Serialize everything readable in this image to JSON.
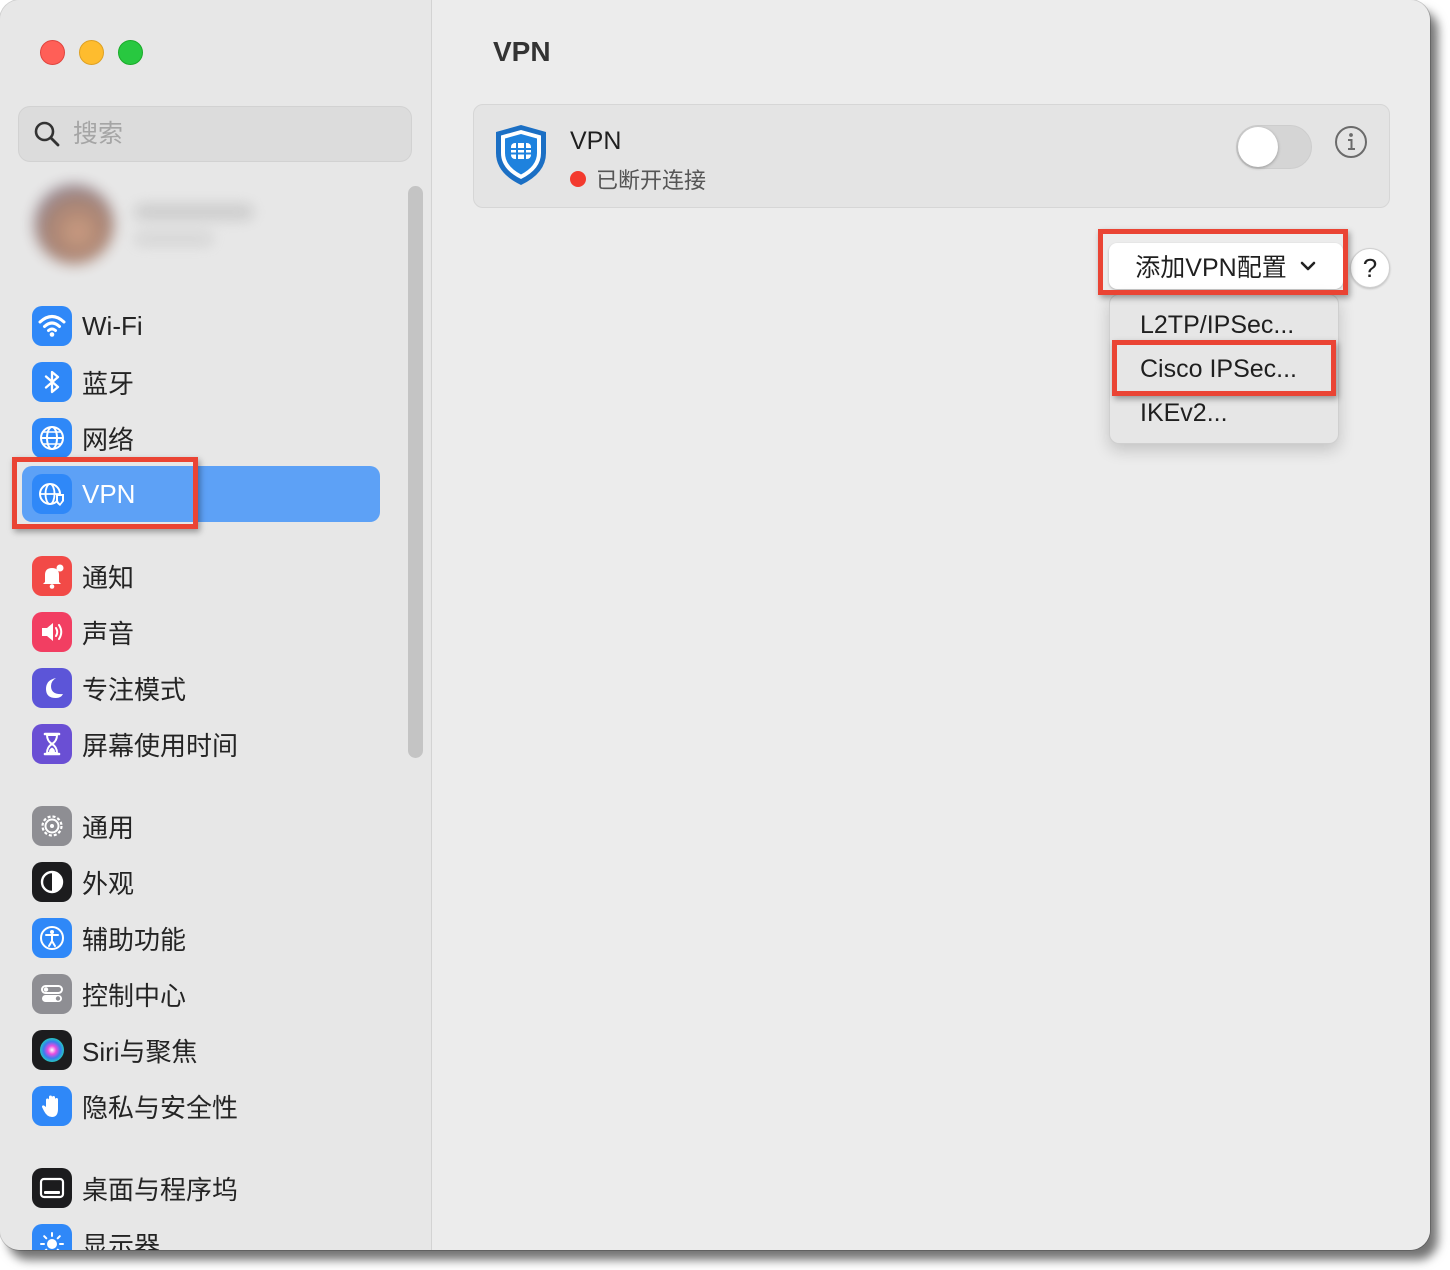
{
  "window": {
    "title": "VPN"
  },
  "sidebar": {
    "search_placeholder": "搜索",
    "items": [
      {
        "label": "Wi-Fi",
        "icon": "wifi-icon",
        "color": "#2f88f8"
      },
      {
        "label": "蓝牙",
        "icon": "bluetooth-icon",
        "color": "#2f88f8"
      },
      {
        "label": "网络",
        "icon": "globe-icon",
        "color": "#2f88f8"
      },
      {
        "label": "VPN",
        "icon": "vpn-globe-icon",
        "color": "#2f88f8",
        "selected": true
      },
      {
        "label": "通知",
        "icon": "bell-icon",
        "color": "#f24a47"
      },
      {
        "label": "声音",
        "icon": "speaker-icon",
        "color": "#f23e62"
      },
      {
        "label": "专注模式",
        "icon": "moon-icon",
        "color": "#5c55d8"
      },
      {
        "label": "屏幕使用时间",
        "icon": "hourglass-icon",
        "color": "#6a4fd4"
      },
      {
        "label": "通用",
        "icon": "gear-icon",
        "color": "#8e8e93"
      },
      {
        "label": "外观",
        "icon": "appearance-icon",
        "color": "#1c1c1e"
      },
      {
        "label": "辅助功能",
        "icon": "accessibility-icon",
        "color": "#2f88f8"
      },
      {
        "label": "控制中心",
        "icon": "control-center-icon",
        "color": "#8e8e93"
      },
      {
        "label": "Siri与聚焦",
        "icon": "siri-icon",
        "color": "#3a3a3c"
      },
      {
        "label": "隐私与安全性",
        "icon": "hand-icon",
        "color": "#2f88f8"
      },
      {
        "label": "桌面与程序坞",
        "icon": "dock-icon",
        "color": "#1c1c1e"
      },
      {
        "label": "显示器",
        "icon": "sun-icon",
        "color": "#2f88f8"
      }
    ]
  },
  "main": {
    "title": "VPN",
    "vpn": {
      "name": "VPN",
      "status": "已断开连接",
      "status_color": "#f33a2e",
      "enabled": false
    },
    "add_button_label": "添加VPN配置",
    "help_label": "?",
    "menu_items": [
      "L2TP/IPSec...",
      "Cisco IPSec...",
      "IKEv2..."
    ]
  },
  "highlight_color": "#ea4434"
}
